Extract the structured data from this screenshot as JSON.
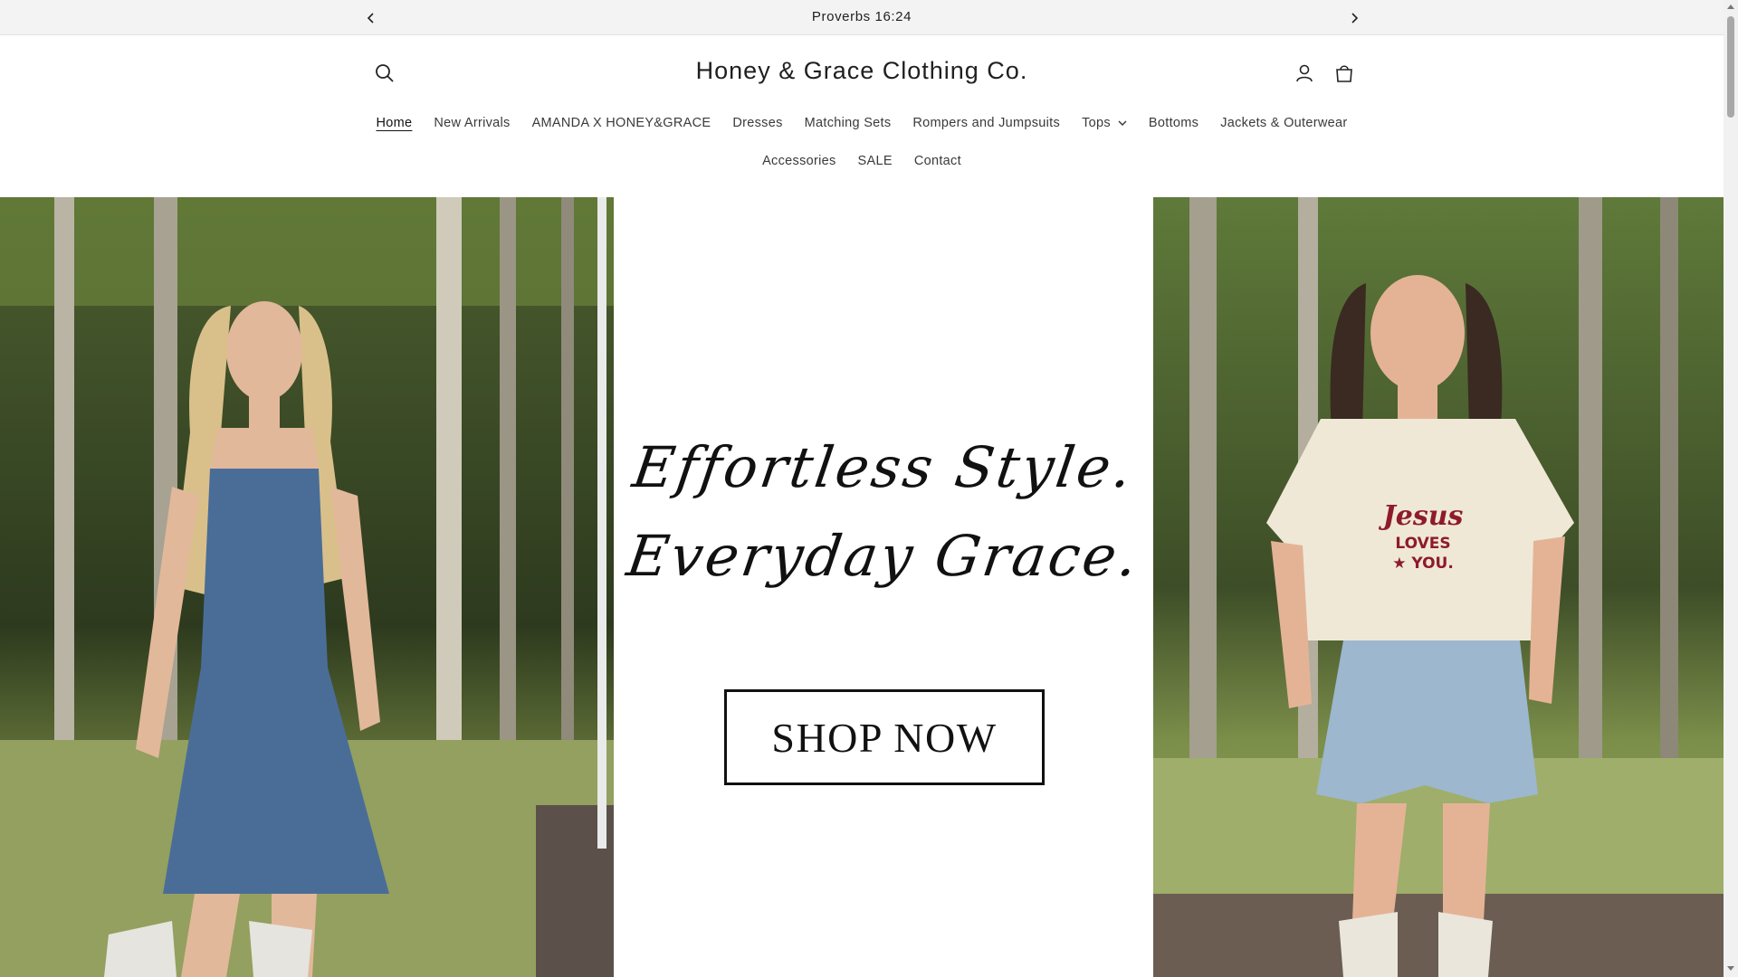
{
  "announcement": {
    "message": "Proverbs 16:24",
    "prev_icon": "chevron-left-icon",
    "next_icon": "chevron-right-icon"
  },
  "header": {
    "logo": "Honey & Grace Clothing Co.",
    "search_icon": "search-icon",
    "account_icon": "account-icon",
    "cart_icon": "cart-icon"
  },
  "nav": {
    "row1": [
      {
        "label": "Home",
        "active": true
      },
      {
        "label": "New Arrivals"
      },
      {
        "label": "AMANDA X HONEY&GRACE"
      },
      {
        "label": "Dresses"
      },
      {
        "label": "Matching Sets"
      },
      {
        "label": "Rompers and Jumpsuits"
      },
      {
        "label": "Tops",
        "dropdown": true
      },
      {
        "label": "Bottoms"
      },
      {
        "label": "Jackets & Outerwear"
      }
    ],
    "row2": [
      {
        "label": "Accessories"
      },
      {
        "label": "SALE"
      },
      {
        "label": "Contact"
      }
    ]
  },
  "hero": {
    "tagline_line1": "Effortless Style.",
    "tagline_line2": "Everyday Grace.",
    "cta": "SHOP NOW",
    "shirt_text": "Jesus LOVES YOU."
  },
  "colors": {
    "announcement_bg": "#f3f3f3",
    "text": "#121212",
    "shirt_print": "#8e1b2a"
  }
}
